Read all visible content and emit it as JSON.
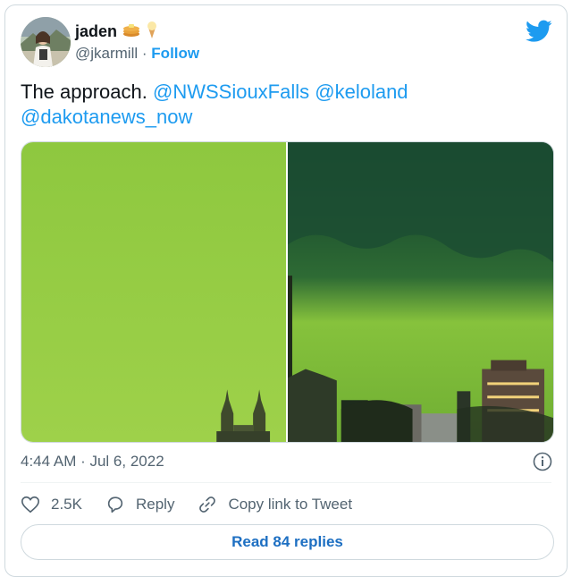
{
  "user": {
    "name": "jaden",
    "handle": "@jkarmill",
    "separator": "·",
    "follow_label": "Follow",
    "emojis": [
      "pancakes-icon",
      "ice-cream-icon"
    ]
  },
  "tweet": {
    "text_lead": "The approach. ",
    "mentions": [
      "@NWSSiouxFalls",
      "@keloland",
      "@dakotanews_now"
    ]
  },
  "media": {
    "photos": [
      "green-sky-photo-cathedral-spires",
      "green-storm-cloud-photo-city"
    ]
  },
  "timestamp": "4:44 AM · Jul 6, 2022",
  "actions": {
    "like_count": "2.5K",
    "reply_label": "Reply",
    "copy_label": "Copy link to Tweet"
  },
  "read_replies_label": "Read 84 replies",
  "colors": {
    "accent": "#1d9bf0",
    "text": "#0f1419",
    "muted": "#536471"
  }
}
